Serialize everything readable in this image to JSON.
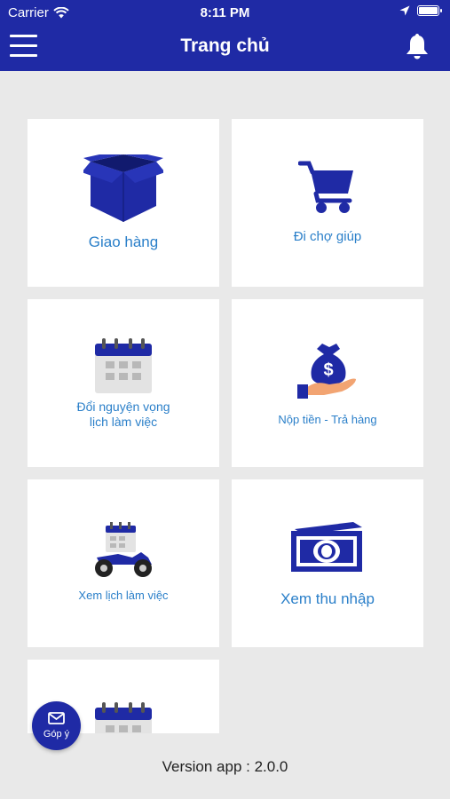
{
  "status_bar": {
    "carrier": "Carrier",
    "time": "8:11 PM"
  },
  "header": {
    "title": "Trang chủ"
  },
  "tiles": [
    {
      "label": "Giao hàng",
      "icon": "box-icon"
    },
    {
      "label": "Đi chợ giúp",
      "icon": "shopping-cart-icon"
    },
    {
      "label": "Đổi nguyện vọng\nlịch làm việc",
      "icon": "calendar-icon"
    },
    {
      "label": "Nộp tiền - Trả hàng",
      "icon": "money-bag-hand-icon"
    },
    {
      "label": "Xem lịch làm việc",
      "icon": "motorbike-calendar-icon"
    },
    {
      "label": "Xem thu nhập",
      "icon": "banknote-icon"
    },
    {
      "label": "",
      "icon": "calendar-icon"
    }
  ],
  "feedback": {
    "label": "Góp ý"
  },
  "footer": {
    "version": "Version app : 2.0.0"
  },
  "colors": {
    "primary": "#1f2aa5",
    "label": "#2a7fc9",
    "background": "#e9e9e9"
  }
}
